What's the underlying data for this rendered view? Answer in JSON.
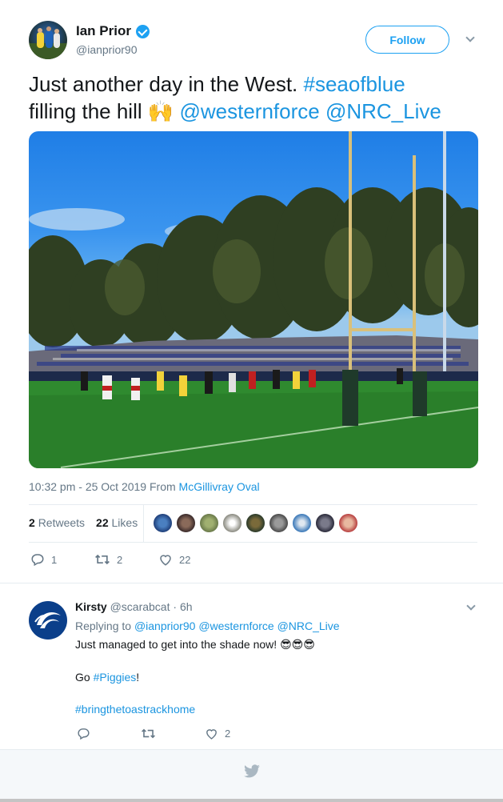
{
  "tweet": {
    "author": {
      "name": "Ian Prior",
      "handle": "@ianprior90",
      "verified": true
    },
    "follow_label": "Follow",
    "text_plain_1": "Just another day in the West. ",
    "hashtag_1": "#seaofblue",
    "text_plain_2": "filling the hill ",
    "emoji": "🙌",
    "mention_1": "@westernforce",
    "mention_2": "@NRC_Live",
    "timestamp": "10:32 pm - 25 Oct 2019 From ",
    "location": "McGillivray Oval",
    "stats": {
      "retweets_count": "2",
      "retweets_label": "Retweets",
      "likes_count": "22",
      "likes_label": "Likes"
    },
    "likers": [
      "#1f3f7a",
      "#3a2a2a",
      "#6a7a4a",
      "#c8c8c0",
      "#2a3a2a",
      "#4a4a4a",
      "#3a78b8",
      "#2a2a3a",
      "#b84040"
    ],
    "actions": {
      "replies": "1",
      "retweets": "2",
      "likes": "22"
    }
  },
  "reply": {
    "name": "Kirsty",
    "handle": "@scarabcat",
    "time": "· 6h",
    "replying_to_label": "Replying to ",
    "replying_to": [
      "@ianprior90",
      "@westernforce",
      "@NRC_Live"
    ],
    "line1": "Just managed to get into the shade now! ",
    "line1_emoji": "😎😎😎",
    "line2_prefix": "Go ",
    "line2_hashtag": "#Piggies",
    "line2_suffix": "!",
    "line3_hashtag": "#bringthetoastrackhome",
    "actions": {
      "replies": "",
      "retweets": "",
      "likes": "2"
    }
  },
  "footer": {
    "icon": "twitter-bird-icon"
  },
  "colors": {
    "accent": "#1da1f2",
    "link": "#1b95e0",
    "muted": "#657786"
  }
}
